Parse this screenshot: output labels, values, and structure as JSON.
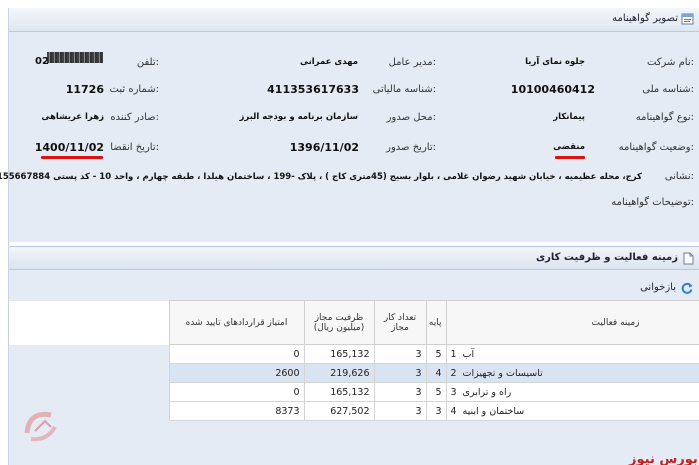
{
  "header": {
    "title": "تصویر گواهینامه"
  },
  "company": {
    "name_label": "نام شرکت:",
    "name": "جلوه نمای آریا",
    "ceo_label": "مدیر عامل:",
    "ceo": "مهدی عمرانی",
    "phone_label": "تلفن:",
    "phone": "02",
    "national_id_label": "شناسه ملی:",
    "national_id": "10100460412",
    "tax_id_label": "شناسه مالیاتی:",
    "tax_id": "411353617633",
    "reg_no_label": "شماره ثبت:",
    "reg_no": "11726",
    "cert_type_label": "نوع گواهینامه:",
    "cert_type": "پیمانکار",
    "issue_place_label": "محل صدور:",
    "issue_place": "سازمان برنامه و بودجه البرز",
    "issuer_label": "صادر کننده:",
    "issuer": "زهرا عریشاهی",
    "status_label": "وضعیت گواهینامه:",
    "status": "منقضی",
    "issue_date_label": "تاریخ صدور:",
    "issue_date": "1396/11/02",
    "expire_date_label": "تاریخ انقضا:",
    "expire_date": "1400/11/02",
    "address_label": "نشانی:",
    "address": "کرج، محله عظیمیه ، خیابان شهید رضوان غلامی ، بلوار بسیج (45متری کاج ) ، پلاک -199 ، ساختمان هیلدا ، طبقه چهارم ، واحد 10 - کد پستی 3155667884",
    "notes_label": "توضیحات گواهینامه:"
  },
  "activities": {
    "title": "زمینه فعالیت و ظرفیت کاری",
    "refresh_label": "بازخوانی",
    "columns": {
      "field": "زمینه فعالیت",
      "grade": "پایه",
      "work_count": "تعداد کار مجاز",
      "capacity": "ظرفیت مجاز (میلیون ریال)",
      "score": "امتیاز قراردادهای تایید شده"
    },
    "rows": [
      {
        "no": "1",
        "field": "آب",
        "grade": "5",
        "work_count": "3",
        "capacity": "165,132",
        "score": "0"
      },
      {
        "no": "2",
        "field": "تاسیسات و تجهیزات",
        "grade": "4",
        "work_count": "3",
        "capacity": "219,626",
        "score": "2600"
      },
      {
        "no": "3",
        "field": "راه و ترابری",
        "grade": "5",
        "work_count": "3",
        "capacity": "165,132",
        "score": "0"
      },
      {
        "no": "4",
        "field": "ساختمان و ابنیه",
        "grade": "3",
        "work_count": "3",
        "capacity": "627,502",
        "score": "8373"
      }
    ]
  },
  "watermark": {
    "brand": "بورس نیوز"
  },
  "colors": {
    "panel_bg": "#e4ebf4",
    "selected_row": "#d9e4f2",
    "highlight_red": "#e01010",
    "brand_red": "#c41f1f"
  }
}
